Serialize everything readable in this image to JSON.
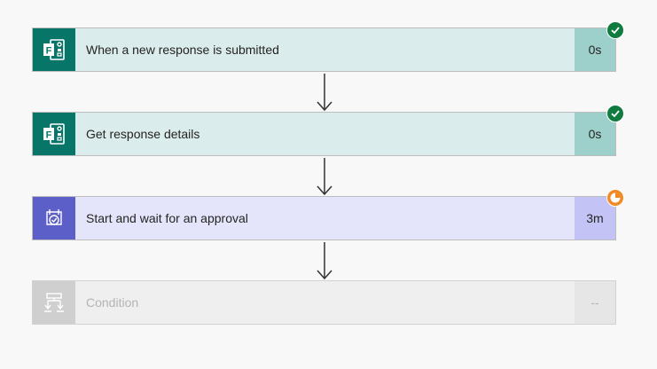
{
  "flow": {
    "steps": [
      {
        "title": "When a new response is submitted",
        "duration": "0s",
        "status": "succeeded",
        "icon": "microsoft-forms-icon"
      },
      {
        "title": "Get response details",
        "duration": "0s",
        "status": "succeeded",
        "icon": "microsoft-forms-icon"
      },
      {
        "title": "Start and wait for an approval",
        "duration": "3m",
        "status": "running",
        "icon": "approvals-icon"
      },
      {
        "title": "Condition",
        "duration": "--",
        "status": "not-run",
        "icon": "condition-icon"
      }
    ]
  },
  "colors": {
    "forms_accent": "#077568",
    "approval_accent": "#5b5fc7",
    "success": "#0f7b3f",
    "running": "#f08a24"
  }
}
